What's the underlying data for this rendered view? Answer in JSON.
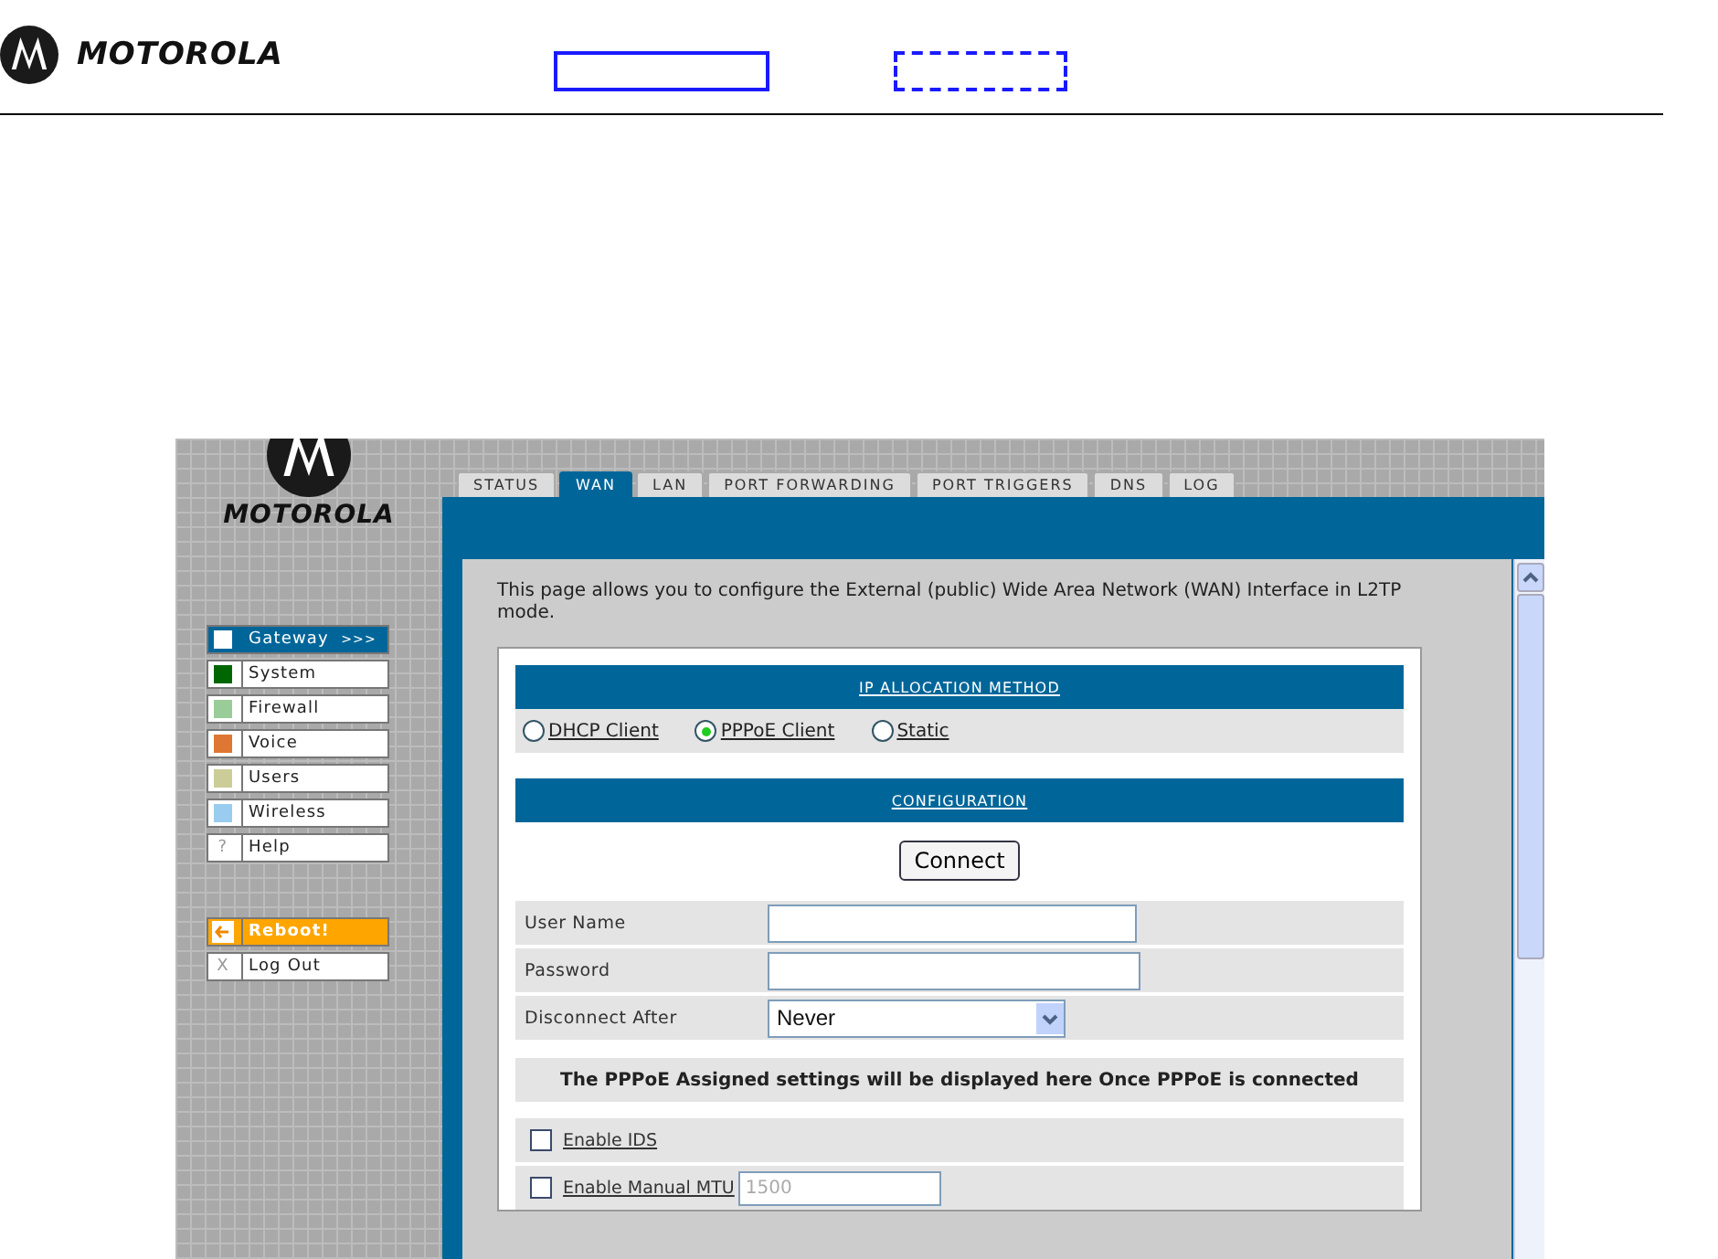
{
  "document_header": {
    "brand": "MOTOROLA"
  },
  "router_ui": {
    "brand": "MOTOROLA",
    "tabs": [
      {
        "label": "STATUS",
        "selected": false
      },
      {
        "label": "WAN",
        "selected": true
      },
      {
        "label": "LAN",
        "selected": false
      },
      {
        "label": "PORT FORWARDING",
        "selected": false
      },
      {
        "label": "PORT TRIGGERS",
        "selected": false
      },
      {
        "label": "DNS",
        "selected": false
      },
      {
        "label": "LOG",
        "selected": false
      }
    ],
    "sidebar": {
      "items": [
        {
          "label": "Gateway",
          "kind": "swatch",
          "color": "#ffffff",
          "selected": true,
          "suffix": ">>>"
        },
        {
          "label": "System",
          "kind": "swatch",
          "color": "#006600",
          "selected": false
        },
        {
          "label": "Firewall",
          "kind": "swatch",
          "color": "#99cc99",
          "selected": false
        },
        {
          "label": "Voice",
          "kind": "swatch",
          "color": "#dd7733",
          "selected": false
        },
        {
          "label": "Users",
          "kind": "swatch",
          "color": "#cccc99",
          "selected": false
        },
        {
          "label": "Wireless",
          "kind": "swatch",
          "color": "#99ccee",
          "selected": false
        },
        {
          "label": "Help",
          "kind": "glyph",
          "glyph": "?",
          "selected": false
        }
      ],
      "actions": [
        {
          "label": "Reboot!",
          "kind": "action"
        },
        {
          "label": "Log Out",
          "kind": "glyph",
          "glyph": "X"
        }
      ]
    },
    "intro": "This page allows you to configure the External (public) Wide Area Network (WAN) Interface in L2TP mode.",
    "ip_allocation": {
      "title": "IP ALLOCATION METHOD",
      "options": [
        {
          "label": "DHCP Client",
          "selected": false
        },
        {
          "label": "PPPoE Client",
          "selected": true
        },
        {
          "label": "Static",
          "selected": false
        }
      ]
    },
    "configuration": {
      "title": "CONFIGURATION",
      "connect_button": "Connect",
      "fields": [
        {
          "label": "User Name",
          "kind": "text"
        },
        {
          "label": "Password",
          "kind": "password"
        },
        {
          "label": "Disconnect After",
          "kind": "select",
          "value": "Never"
        }
      ],
      "notice": "The PPPoE Assigned settings will be displayed here Once PPPoE is connected",
      "options": [
        {
          "label": "Enable IDS",
          "checked": false
        },
        {
          "label": "Enable Manual MTU",
          "checked": false,
          "value": "1500",
          "disabled": true
        }
      ]
    }
  }
}
